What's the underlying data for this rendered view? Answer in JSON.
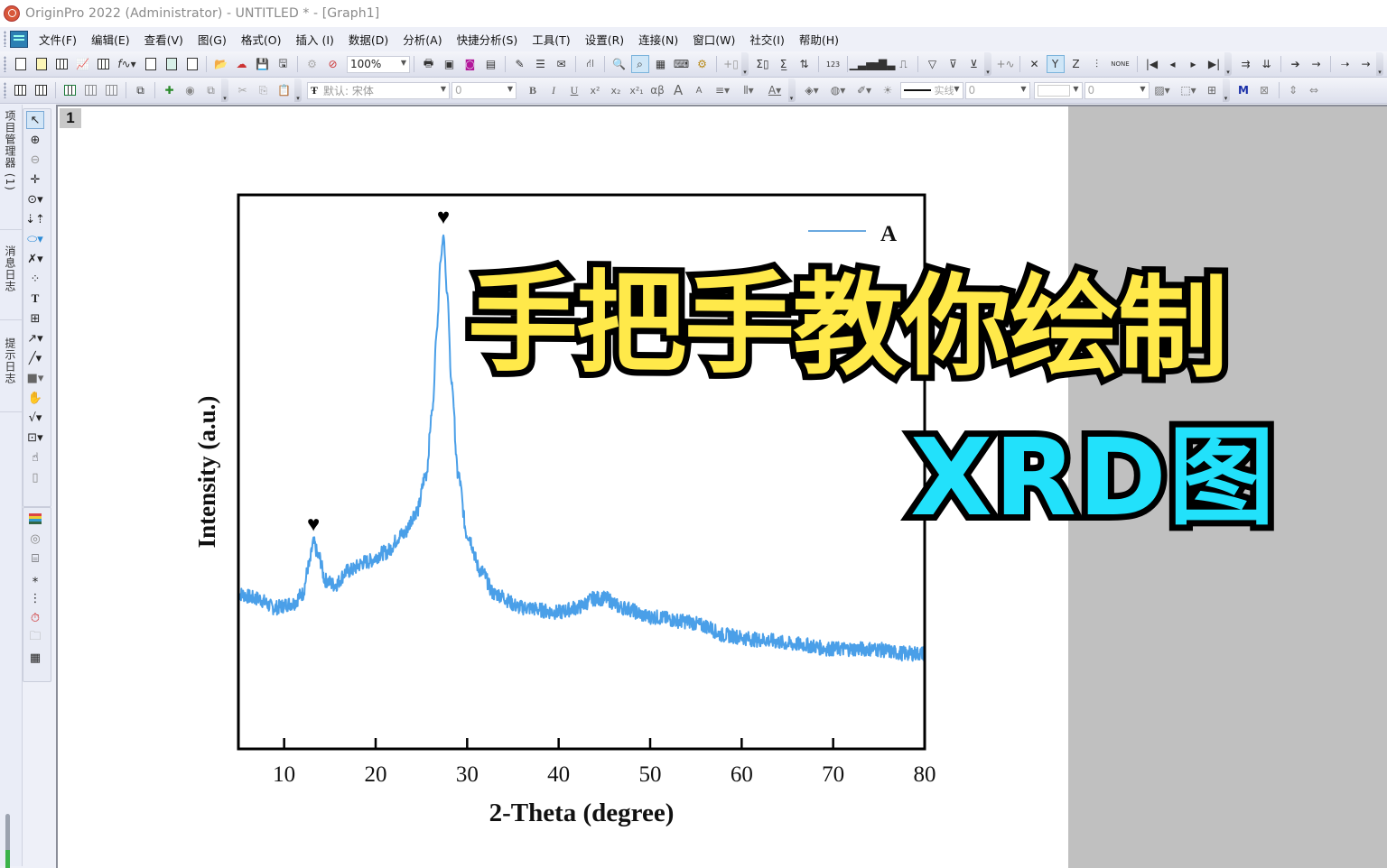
{
  "window": {
    "title": "OriginPro 2022 (Administrator) - UNTITLED * - [Graph1]"
  },
  "menubar": {
    "items": [
      "文件(F)",
      "编辑(E)",
      "查看(V)",
      "图(G)",
      "格式(O)",
      "插入 (I)",
      "数据(D)",
      "分析(A)",
      "快捷分析(S)",
      "工具(T)",
      "设置(R)",
      "连接(N)",
      "窗口(W)",
      "社交(I)",
      "帮助(H)"
    ]
  },
  "toolbar1": {
    "zoom_value": "100%",
    "y_button_label": "Y",
    "z_button_label": "Z",
    "none_label": "NONE"
  },
  "toolbar2": {
    "font_value": "默认: 宋体",
    "font_size_value": "0",
    "bold_label": "B",
    "italic_label": "I",
    "underline_label": "U",
    "greek_label": "αβ",
    "line_style_value": "实线",
    "line_width_value": "0",
    "pattern_value": "0",
    "marker_label": "M"
  },
  "left_panel": {
    "tabs": [
      "项目管理器 (1)",
      "消息日志",
      "提示日志"
    ]
  },
  "graph": {
    "layer_label": "1"
  },
  "overlay": {
    "headline": "手把手教你绘制",
    "subheadline": "XRD图",
    "headline_color": "#ffe94a",
    "subheadline_color": "#22e1fb"
  },
  "chart_data": {
    "type": "line",
    "title": "",
    "xlabel": "2-Theta (degree)",
    "ylabel": "Intensity (a.u.)",
    "xlim": [
      5,
      80
    ],
    "ylim": [
      0,
      100
    ],
    "xticks": [
      10,
      20,
      30,
      40,
      50,
      60,
      70,
      80
    ],
    "grid": false,
    "legend": {
      "placement": "top-right",
      "entries": [
        "A"
      ]
    },
    "series": [
      {
        "name": "A",
        "color": "#4a9fe8",
        "x": [
          5,
          7,
          9,
          11,
          12,
          12.7,
          13.2,
          13.8,
          14.5,
          15.5,
          17,
          19,
          21,
          23,
          24.5,
          25.5,
          26.2,
          26.7,
          27.1,
          27.4,
          27.8,
          28.3,
          29,
          30,
          31.5,
          33,
          36,
          40,
          42,
          44,
          45,
          47,
          50,
          54,
          56,
          58,
          62,
          66,
          70,
          74,
          78,
          80
        ],
        "y": [
          22,
          21,
          19,
          20,
          22,
          28,
          33,
          30,
          25,
          24,
          27,
          29,
          31,
          35,
          40,
          48,
          62,
          80,
          95,
          100,
          88,
          68,
          48,
          35,
          27,
          22,
          19,
          18,
          19,
          21,
          21,
          19,
          17,
          16,
          15,
          13,
          12,
          11,
          10,
          10,
          9,
          9
        ]
      }
    ],
    "annotations": [
      {
        "text": "♥",
        "x": 13.2,
        "label": "peak marker"
      },
      {
        "text": "♥",
        "x": 27.4,
        "label": "peak marker"
      }
    ]
  }
}
